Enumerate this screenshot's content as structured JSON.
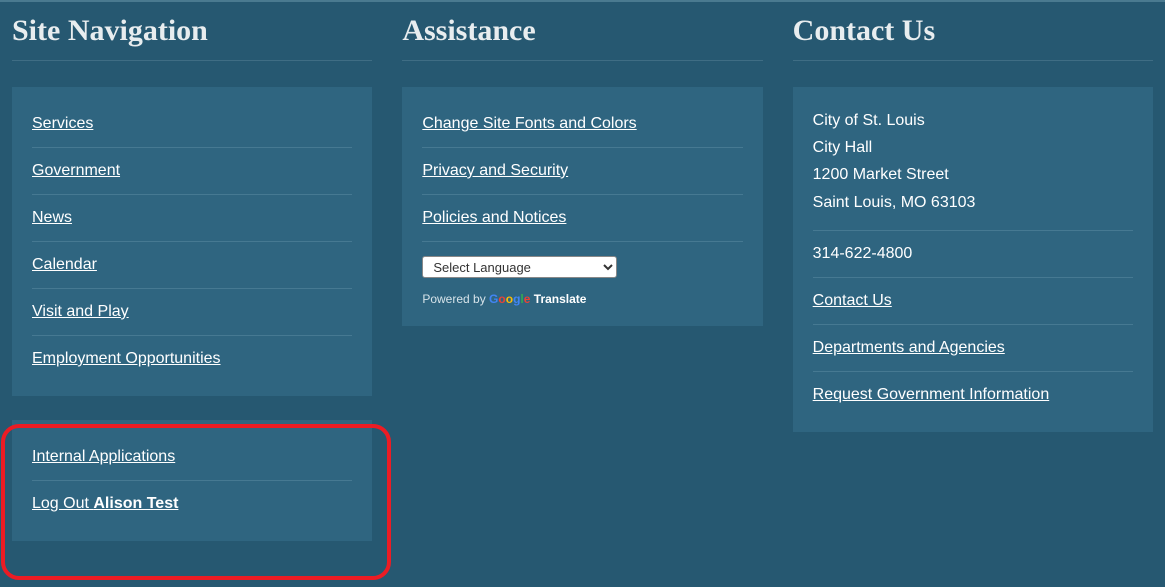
{
  "siteNavigation": {
    "title": "Site Navigation",
    "links": {
      "services": "Services",
      "government": "Government",
      "news": "News",
      "calendar": "Calendar",
      "visit": "Visit and Play",
      "employment": "Employment Opportunities"
    },
    "internal": {
      "apps": "Internal Applications",
      "logoutPrefix": "Log Out ",
      "logoutUser": "Alison Test"
    }
  },
  "assistance": {
    "title": "Assistance",
    "links": {
      "fonts": "Change Site Fonts and Colors",
      "privacy": "Privacy and Security",
      "policies": "Policies and Notices"
    },
    "translate": {
      "selectLabel": "Select Language",
      "poweredBy": "Powered by ",
      "translateWord": " Translate"
    }
  },
  "contact": {
    "title": "Contact Us",
    "address": {
      "line1": "City of St. Louis",
      "line2": "City Hall",
      "line3": "1200 Market Street",
      "line4": "Saint Louis, MO 63103"
    },
    "phone": "314-622-4800",
    "links": {
      "contactUs": "Contact Us",
      "departments": "Departments and Agencies",
      "request": "Request Government Information"
    }
  }
}
